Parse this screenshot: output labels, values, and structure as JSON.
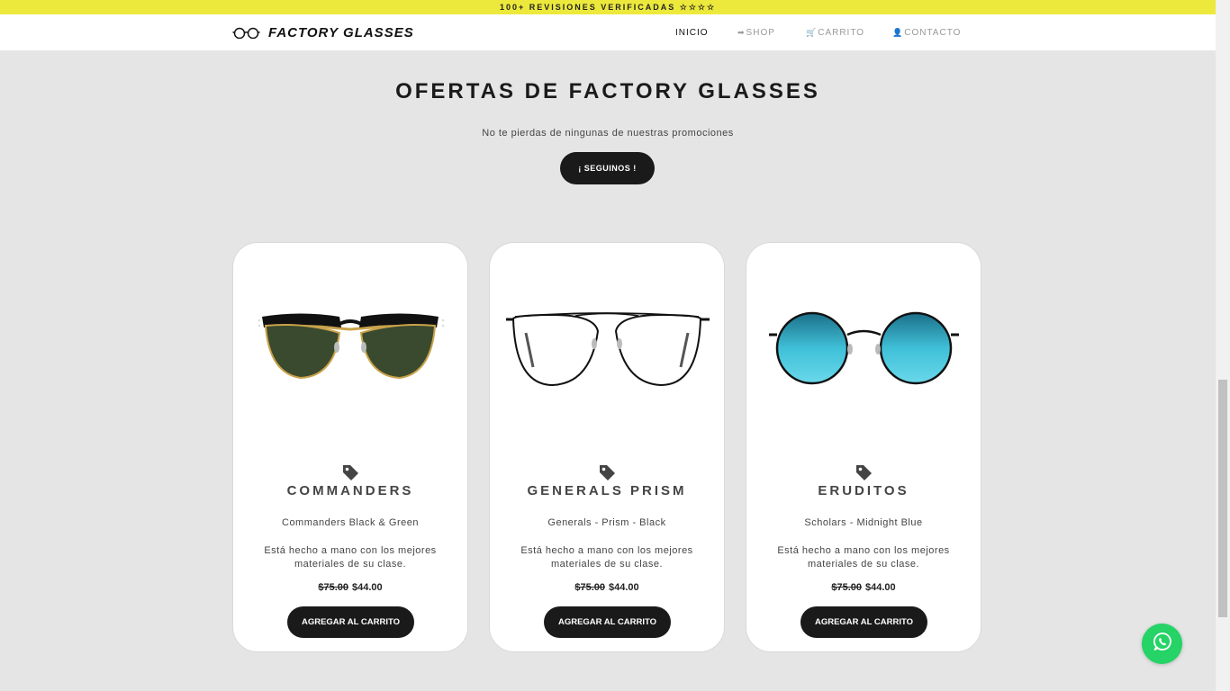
{
  "announcement": "100+ REVISIONES VERIFICADAS ☆☆☆☆",
  "brand": {
    "name": "FACTORY GLASSES",
    "logo_icon": "glasses-icon"
  },
  "nav": [
    {
      "label": "INICIO",
      "icon": ""
    },
    {
      "label": "SHOP",
      "icon": "➡"
    },
    {
      "label": "CARRITO",
      "icon": "🛒"
    },
    {
      "label": "CONTACTO",
      "icon": "👤"
    }
  ],
  "hero": {
    "title": "OFERTAS DE FACTORY GLASSES",
    "subtitle": "No te pierdas de ningunas de nuestras promociones",
    "button": "¡ SEGUINOS !"
  },
  "products": [
    {
      "name": "COMMANDERS",
      "variant": "Commanders Black & Green",
      "description": "Está hecho a mano con los mejores materiales de su clase.",
      "old_price": "$75.00",
      "price": "$44.00",
      "button": "AGREGAR AL CARRITO",
      "image": "clubmaster-sunglasses-green-lens"
    },
    {
      "name": "GENERALS PRISM",
      "variant": "Generals - Prism - Black",
      "description": "Está hecho a mano con los mejores materiales de su clase.",
      "old_price": "$75.00",
      "price": "$44.00",
      "button": "AGREGAR AL CARRITO",
      "image": "aviator-clear-glasses"
    },
    {
      "name": "ERUDITOS",
      "variant": "Scholars - Midnight Blue",
      "description": "Está hecho a mano con los mejores materiales de su clase.",
      "old_price": "$75.00",
      "price": "$44.00",
      "button": "AGREGAR AL CARRITO",
      "image": "round-blue-lens-sunglasses"
    }
  ],
  "colors": {
    "announcement_bg": "#ece93c",
    "page_bg": "#e5e5e5",
    "button_bg": "#1a1a1a",
    "whatsapp": "#25d366"
  },
  "floating": {
    "icon": "whatsapp-icon"
  }
}
